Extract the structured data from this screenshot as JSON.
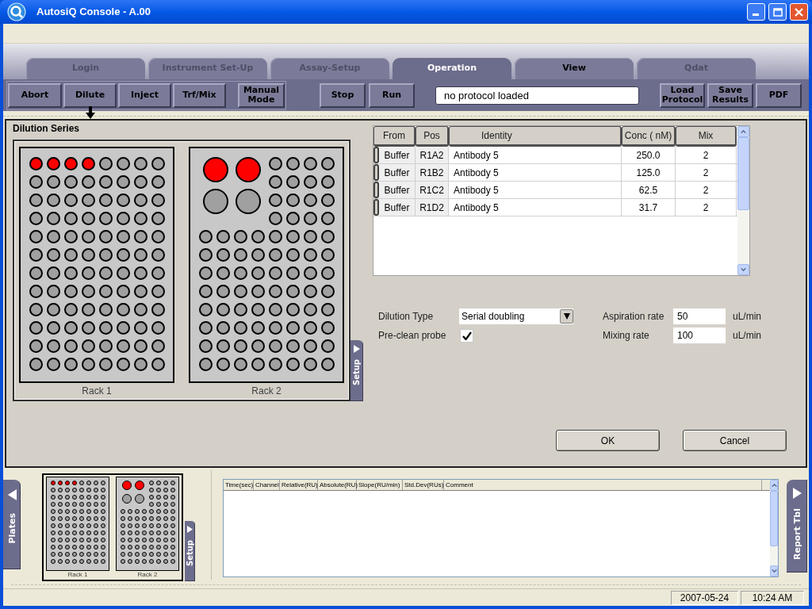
{
  "window": {
    "title": "AutosiQ Console - A.00"
  },
  "tabs": [
    {
      "label": "Login",
      "selected": false,
      "disabled": true
    },
    {
      "label": "Instrument Set-Up",
      "selected": false,
      "disabled": true
    },
    {
      "label": "Assay-Setup",
      "selected": false,
      "disabled": true
    },
    {
      "label": "Operation",
      "selected": true,
      "disabled": false
    },
    {
      "label": "View",
      "selected": false,
      "disabled": false
    },
    {
      "label": "Qdat",
      "selected": false,
      "disabled": true
    }
  ],
  "toolbar": {
    "mode_buttons": [
      {
        "label": "Abort",
        "selected": false
      },
      {
        "label": "Dilute",
        "selected": true
      },
      {
        "label": "Inject",
        "selected": false
      },
      {
        "label": "Trf/Mix",
        "selected": false
      },
      {
        "label": "Manual Mode",
        "selected": false
      }
    ],
    "run_buttons": [
      "Stop",
      "Run"
    ],
    "status_field": {
      "value": "no protocol loaded"
    },
    "file_buttons": [
      "Load Protocol",
      "Save Results",
      "PDF"
    ]
  },
  "dilution": {
    "title": "Dilution Series",
    "racks": [
      {
        "label": "Rack 1",
        "kind": "plate",
        "blocks": [
          {
            "kind": "small",
            "wells": [
              [
                true,
                true,
                true,
                true,
                false,
                false,
                false,
                false
              ],
              [
                false,
                false,
                false,
                false,
                false,
                false,
                false,
                false
              ],
              [
                false,
                false,
                false,
                false,
                false,
                false,
                false,
                false
              ],
              [
                false,
                false,
                false,
                false,
                false,
                false,
                false,
                false
              ],
              [
                false,
                false,
                false,
                false,
                false,
                false,
                false,
                false
              ],
              [
                false,
                false,
                false,
                false,
                false,
                false,
                false,
                false
              ],
              [
                false,
                false,
                false,
                false,
                false,
                false,
                false,
                false
              ],
              [
                false,
                false,
                false,
                false,
                false,
                false,
                false,
                false
              ],
              [
                false,
                false,
                false,
                false,
                false,
                false,
                false,
                false
              ],
              [
                false,
                false,
                false,
                false,
                false,
                false,
                false,
                false
              ],
              [
                false,
                false,
                false,
                false,
                false,
                false,
                false,
                false
              ],
              [
                false,
                false,
                false,
                false,
                false,
                false,
                false,
                false
              ]
            ]
          }
        ]
      },
      {
        "label": "Rack 2",
        "kind": "mixed",
        "blocks": [
          {
            "kind": "large",
            "wells": [
              [
                true,
                true
              ],
              [
                false,
                false
              ]
            ]
          },
          {
            "kind": "small",
            "wells": [
              [
                false,
                false,
                false,
                false
              ],
              [
                false,
                false,
                false,
                false
              ],
              [
                false,
                false,
                false,
                false
              ],
              [
                false,
                false,
                false,
                false
              ]
            ]
          },
          {
            "kind": "small",
            "wells": [
              [
                false,
                false,
                false,
                false,
                false,
                false,
                false,
                false
              ],
              [
                false,
                false,
                false,
                false,
                false,
                false,
                false,
                false
              ],
              [
                false,
                false,
                false,
                false,
                false,
                false,
                false,
                false
              ],
              [
                false,
                false,
                false,
                false,
                false,
                false,
                false,
                false
              ],
              [
                false,
                false,
                false,
                false,
                false,
                false,
                false,
                false
              ],
              [
                false,
                false,
                false,
                false,
                false,
                false,
                false,
                false
              ],
              [
                false,
                false,
                false,
                false,
                false,
                false,
                false,
                false
              ],
              [
                false,
                false,
                false,
                false,
                false,
                false,
                false,
                false
              ]
            ]
          }
        ]
      }
    ],
    "setup_tab": {
      "label": "Setup"
    },
    "table": {
      "columns": [
        "From",
        "Pos",
        "Identity",
        "Conc ( nM)",
        "Mix"
      ],
      "rows": [
        {
          "from": "Buffer",
          "pos": "R1A2",
          "identity": "Antibody 5",
          "conc": "250.0",
          "mix": "2"
        },
        {
          "from": "Buffer",
          "pos": "R1B2",
          "identity": "Antibody 5",
          "conc": "125.0",
          "mix": "2"
        },
        {
          "from": "Buffer",
          "pos": "R1C2",
          "identity": "Antibody 5",
          "conc": "62.5",
          "mix": "2"
        },
        {
          "from": "Buffer",
          "pos": "R1D2",
          "identity": "Antibody 5",
          "conc": "31.7",
          "mix": "2"
        }
      ]
    },
    "form": {
      "dilution_type": {
        "label": "Dilution Type",
        "value": "Serial doubling"
      },
      "pre_clean_probe": {
        "label": "Pre-clean probe",
        "checked": true
      },
      "aspiration_rate": {
        "label": "Aspiration rate",
        "value": "50",
        "unit": "uL/min"
      },
      "mixing_rate": {
        "label": "Mixing rate",
        "value": "100",
        "unit": "uL/min"
      }
    },
    "buttons": [
      "OK",
      "Cancel"
    ]
  },
  "bottom": {
    "plates_tab": {
      "label": "Plates"
    },
    "preview": {
      "rack_labels": [
        "Rack 1",
        "Rack 2"
      ]
    },
    "setup_tab": {
      "label": "Setup"
    },
    "report_table": {
      "columns": [
        "Time(sec)",
        "Channel",
        "Relative(RU)",
        "Absolute(RU)",
        "Slope(RU/min)",
        "Std.Dev(RUs)",
        "Comment"
      ]
    },
    "report_tab": {
      "label": "Report Tbl"
    }
  },
  "status_bar": {
    "date": "2007-05-24",
    "time": "10:24 AM"
  }
}
